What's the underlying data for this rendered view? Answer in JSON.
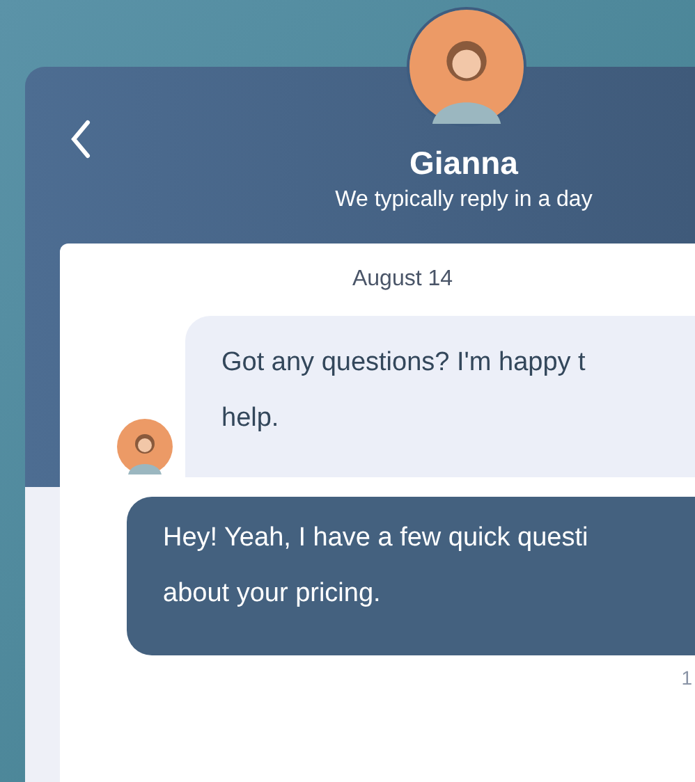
{
  "header": {
    "name": "Gianna",
    "subtitle": "We typically reply in a day"
  },
  "date": "August 14",
  "messages": [
    {
      "kind": "agent",
      "lines": [
        "Got any questions? I'm happy t",
        "help."
      ]
    },
    {
      "kind": "visitor",
      "lines": [
        "Hey! Yeah, I have a few quick questi",
        "about your pricing."
      ],
      "time": "1"
    }
  ]
}
